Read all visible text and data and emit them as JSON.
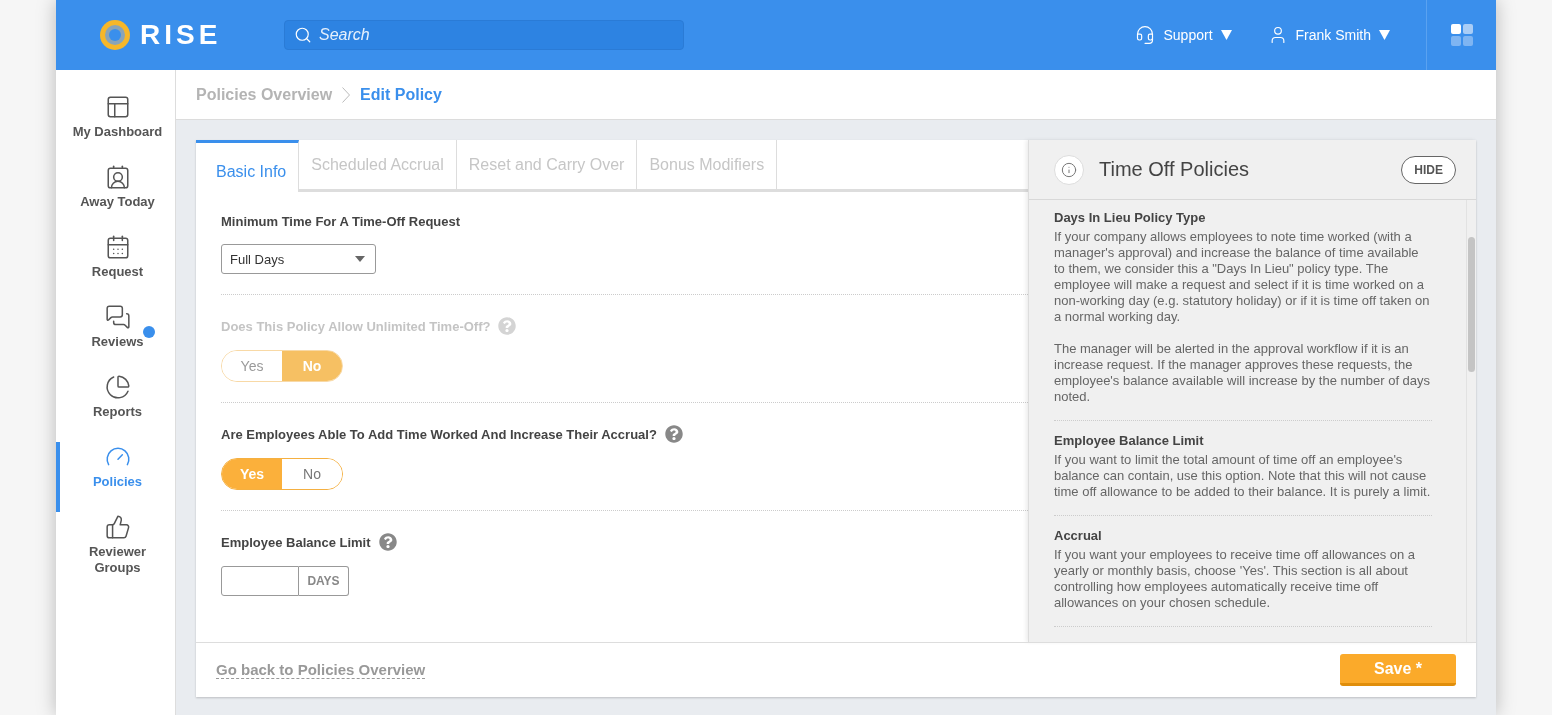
{
  "header": {
    "logo": "RISE",
    "search": {
      "placeholder": "Search"
    },
    "menus": [
      {
        "kind": "support",
        "label": "Support"
      },
      {
        "kind": "user",
        "label": "Frank Smith"
      }
    ]
  },
  "sidebar": {
    "items": [
      {
        "kind": "dashboard",
        "label": "My Dashboard",
        "selected": false,
        "notification": false
      },
      {
        "kind": "away",
        "label": "Away Today",
        "selected": false,
        "notification": false
      },
      {
        "kind": "request",
        "label": "Request",
        "selected": false,
        "notification": false
      },
      {
        "kind": "reviews",
        "label": "Reviews",
        "selected": false,
        "notification": true
      },
      {
        "kind": "reports",
        "label": "Reports",
        "selected": false,
        "notification": false
      },
      {
        "kind": "policies",
        "label": "Policies",
        "selected": true,
        "notification": false
      },
      {
        "kind": "groups",
        "label": "Reviewer Groups",
        "selected": false,
        "notification": false
      }
    ]
  },
  "breadcrumb": [
    {
      "label": "Policies Overview",
      "selected": false
    },
    {
      "label": "Edit Policy",
      "selected": true
    }
  ],
  "tabs": [
    {
      "label": "Basic Info",
      "selected": true
    },
    {
      "label": "Scheduled Accrual",
      "selected": false
    },
    {
      "label": "Reset and Carry Over",
      "selected": false
    },
    {
      "label": "Bonus Modifiers",
      "selected": false
    }
  ],
  "questions": [
    {
      "kind": "select",
      "label": "Minimum Time For A Time-Off Request",
      "disabled": false,
      "value": "Full Days"
    },
    {
      "kind": "toggle",
      "label": "Does This Policy Allow Unlimited Time-Off?",
      "help": true,
      "disabled": true,
      "options": [
        {
          "label": "Yes",
          "selected": false
        },
        {
          "label": "No",
          "selected": true
        }
      ]
    },
    {
      "kind": "toggle",
      "label": "Are Employees Able To Add Time Worked And Increase Their Accrual?",
      "help": true,
      "disabled": false,
      "options": [
        {
          "label": "Yes",
          "selected": true
        },
        {
          "label": "No",
          "selected": false
        }
      ]
    },
    {
      "kind": "number",
      "label": "Employee Balance Limit",
      "help": true,
      "disabled": false,
      "unit": "DAYS"
    }
  ],
  "help_panel": {
    "title": "Time Off Policies",
    "hide_button": "HIDE",
    "sections": [
      {
        "heading": "Days In Lieu Policy Type",
        "paragraphs": [
          "If your company allows employees to note time worked (with a manager's approval) and increase the balance of time available to them, we consider this a \"Days In Lieu\" policy type. The employee will make a request and select if it is time worked on a non-working day (e.g. statutory holiday) or if it is time off taken on a normal working day.",
          "The manager will be alerted in the approval workflow if it is an increase request. If the manager approves these requests, the employee's balance available will increase by the number of days noted."
        ]
      },
      {
        "heading": "Employee Balance Limit",
        "paragraphs": [
          "If you want to limit the total amount of time off an employee's balance can contain, use this option. Note that this will not cause time off allowance to be added to their balance. It is purely a limit."
        ]
      },
      {
        "heading": "Accrual",
        "paragraphs": [
          "If you want your employees to receive time off allowances on a yearly or monthly basis, choose 'Yes'. This section is all about controlling how employees automatically receive time off allowances on your chosen schedule."
        ]
      }
    ]
  },
  "footer": {
    "back_link": "Go back to Policies Overview",
    "save_button": "Save *"
  }
}
